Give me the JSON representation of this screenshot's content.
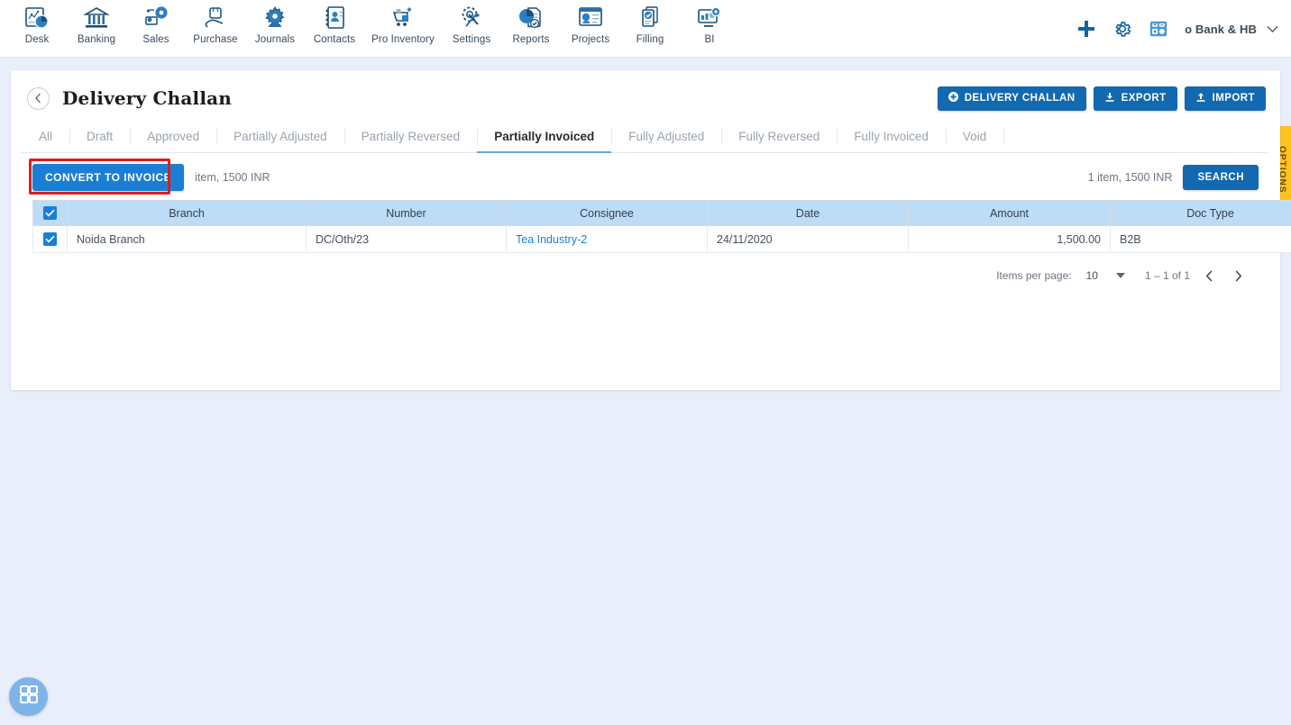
{
  "topnav": {
    "items": [
      {
        "label": "Desk",
        "icon": "dashboard-icon"
      },
      {
        "label": "Banking",
        "icon": "bank-icon"
      },
      {
        "label": "Sales",
        "icon": "sales-icon"
      },
      {
        "label": "Purchase",
        "icon": "purchase-icon"
      },
      {
        "label": "Journals",
        "icon": "journals-icon"
      },
      {
        "label": "Contacts",
        "icon": "contacts-icon"
      },
      {
        "label": "Pro Inventory",
        "icon": "inventory-icon"
      },
      {
        "label": "Settings",
        "icon": "settings-icon"
      },
      {
        "label": "Reports",
        "icon": "reports-icon"
      },
      {
        "label": "Projects",
        "icon": "projects-icon"
      },
      {
        "label": "Filling",
        "icon": "filling-icon"
      },
      {
        "label": "BI",
        "icon": "bi-icon"
      }
    ],
    "add_icon": "plus-icon",
    "settings_icon": "gear-icon",
    "calculator_icon": "calculator-icon",
    "user_name": "o Bank & HB",
    "user_chevron": "chevron-down-icon"
  },
  "header": {
    "back_icon": "chevron-left-icon",
    "title": "Delivery Challan",
    "actions": [
      {
        "label": "DELIVERY CHALLAN",
        "icon": "plus-circle-icon"
      },
      {
        "label": "EXPORT",
        "icon": "download-icon"
      },
      {
        "label": "IMPORT",
        "icon": "upload-icon"
      }
    ]
  },
  "tabs": [
    {
      "label": "All",
      "active": false
    },
    {
      "label": "Draft",
      "active": false
    },
    {
      "label": "Approved",
      "active": false
    },
    {
      "label": "Partially Adjusted",
      "active": false
    },
    {
      "label": "Partially Reversed",
      "active": false
    },
    {
      "label": "Partially Invoiced",
      "active": true
    },
    {
      "label": "Fully Adjusted",
      "active": false
    },
    {
      "label": "Fully Reversed",
      "active": false
    },
    {
      "label": "Fully Invoiced",
      "active": false
    },
    {
      "label": "Void",
      "active": false
    }
  ],
  "toolbar": {
    "convert_label": "CONVERT TO INVOICE",
    "summary_left": "item, 1500 INR",
    "summary_right": "1 item, 1500 INR",
    "search_label": "SEARCH",
    "highlight_color": "#e01b1b"
  },
  "table": {
    "columns": [
      "Branch",
      "Number",
      "Consignee",
      "Date",
      "Amount",
      "Doc Type"
    ],
    "header_checked": true,
    "rows": [
      {
        "checked": true,
        "branch": "Noida Branch",
        "number": "DC/Oth/23",
        "consignee": "Tea Industry-2",
        "date": "24/11/2020",
        "amount": "1,500.00",
        "doc_type": "B2B"
      }
    ]
  },
  "paginator": {
    "items_per_page_label": "Items per page:",
    "items_per_page_value": "10",
    "range_label": "1 – 1 of 1",
    "prev_icon": "chevron-left-icon",
    "next_icon": "chevron-right-icon"
  },
  "options_tab": {
    "label": "OPTIONS",
    "color": "#ffc21f"
  },
  "fab": {
    "icon": "grid-apps-icon"
  }
}
